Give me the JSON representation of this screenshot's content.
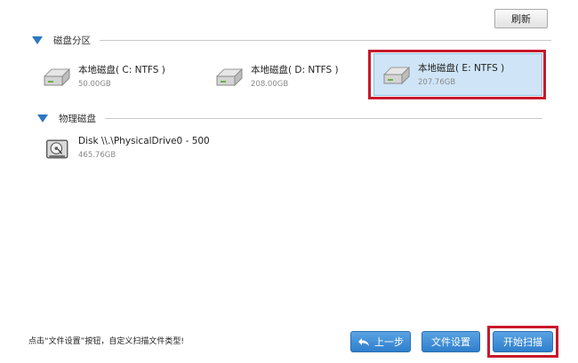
{
  "toolbar": {
    "refresh_label": "刷新"
  },
  "sections": {
    "partitions": {
      "title": "磁盘分区"
    },
    "physical": {
      "title": "物理磁盘"
    }
  },
  "partitions": [
    {
      "name": "本地磁盘( C: NTFS )",
      "size": "50.00GB",
      "selected": false
    },
    {
      "name": "本地磁盘( D: NTFS )",
      "size": "208.00GB",
      "selected": false
    },
    {
      "name": "本地磁盘( E: NTFS )",
      "size": "207.76GB",
      "selected": true
    }
  ],
  "physical_disks": [
    {
      "name": "Disk \\\\.\\PhysicalDrive0 - 500",
      "size": "465.76GB"
    }
  ],
  "footer": {
    "hint": "点击“文件设置”按钮，自定义扫描文件类型!",
    "back_label": "上一步",
    "file_settings_label": "文件设置",
    "start_scan_label": "开始扫描"
  },
  "colors": {
    "accent": "#2f7fcd",
    "selected_bg": "#cfe5f7",
    "highlight": "#c8182b"
  },
  "icons": {
    "partition": "hard-drive-icon",
    "physical": "physical-disk-icon",
    "back": "back-arrow-icon",
    "section": "triangle-down-icon"
  }
}
